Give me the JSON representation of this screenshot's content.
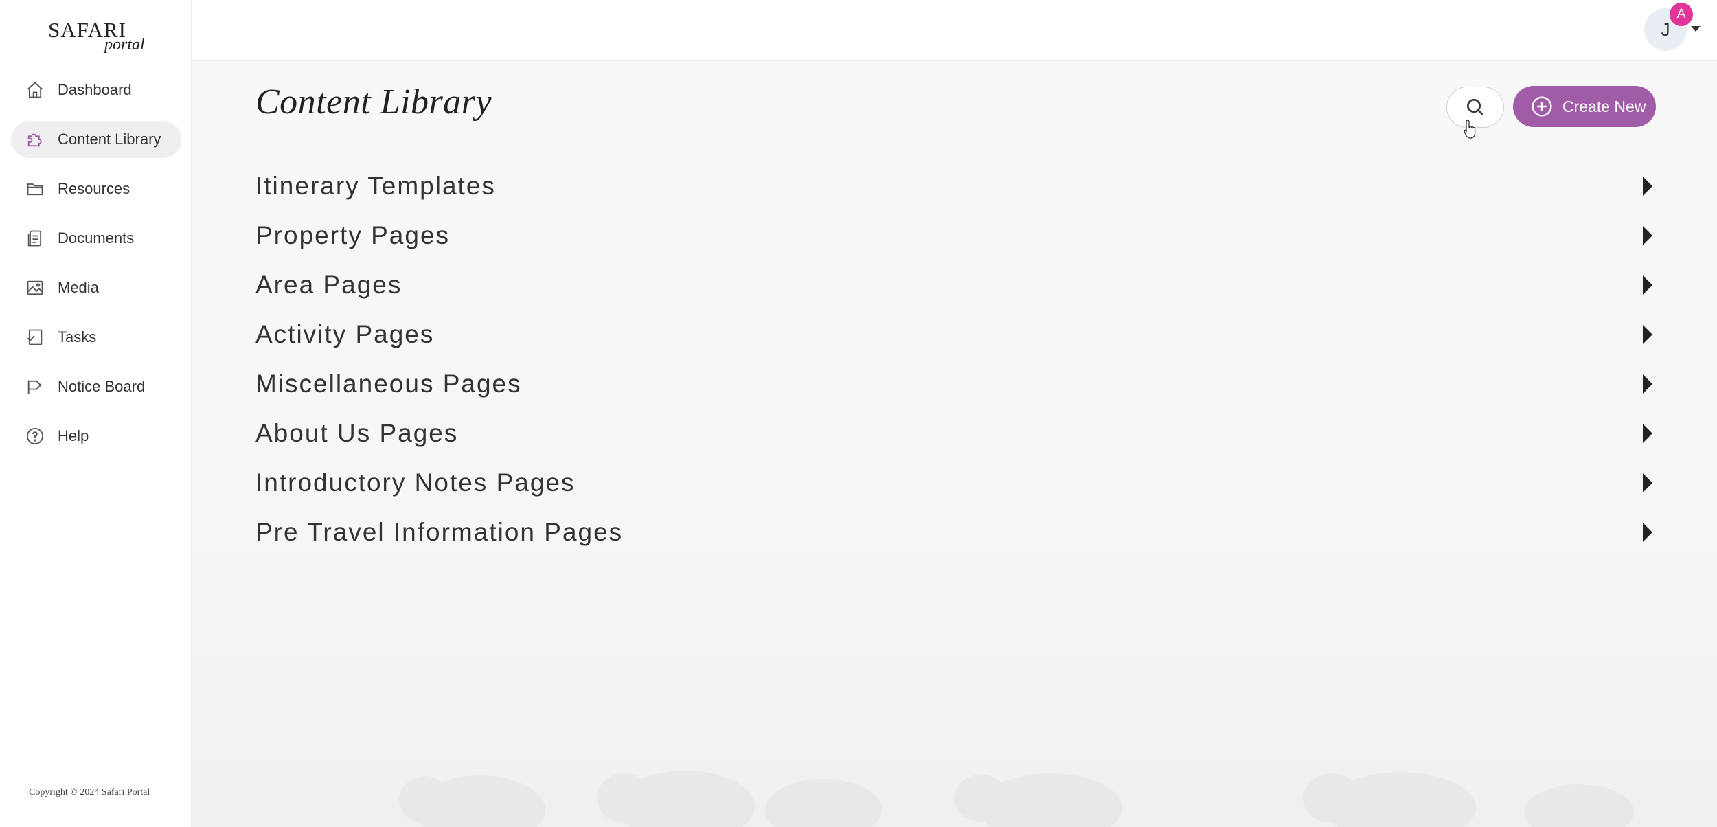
{
  "brand": {
    "line1": "SAFARI",
    "line2": "portal"
  },
  "sidebar": {
    "items": [
      {
        "label": "Dashboard",
        "icon": "home-icon",
        "active": false
      },
      {
        "label": "Content Library",
        "icon": "puzzle-icon",
        "active": true
      },
      {
        "label": "Resources",
        "icon": "folder-icon",
        "active": false
      },
      {
        "label": "Documents",
        "icon": "document-icon",
        "active": false
      },
      {
        "label": "Media",
        "icon": "image-icon",
        "active": false
      },
      {
        "label": "Tasks",
        "icon": "task-icon",
        "active": false
      },
      {
        "label": "Notice Board",
        "icon": "flag-icon",
        "active": false
      },
      {
        "label": "Help",
        "icon": "help-icon",
        "active": false
      }
    ],
    "copyright": "Copyright © 2024 Safari Portal"
  },
  "header": {
    "avatar_initial": "J",
    "avatar_badge": "A"
  },
  "main": {
    "title": "Content Library",
    "create_label": "Create New",
    "sections": [
      "Itinerary Templates",
      "Property Pages",
      "Area Pages",
      "Activity Pages",
      "Miscellaneous Pages",
      "About Us Pages",
      "Introductory Notes Pages",
      "Pre Travel Information Pages"
    ]
  },
  "colors": {
    "accent": "#a15ca8",
    "badge": "#e0369a",
    "active_bg": "#f1eef1"
  }
}
